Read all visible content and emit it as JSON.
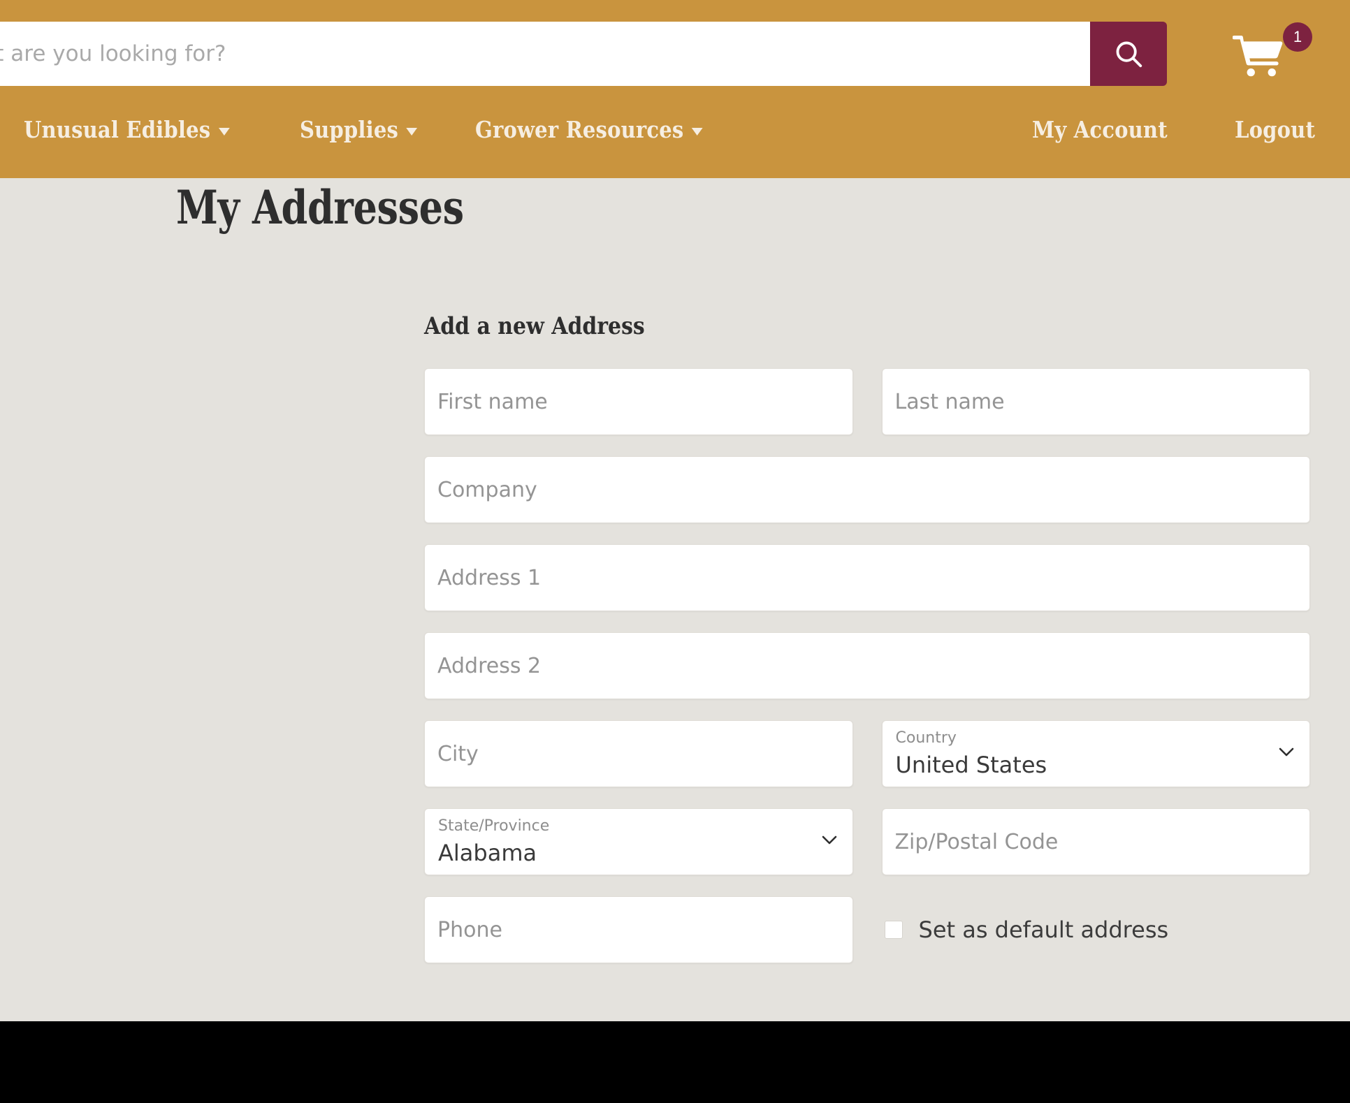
{
  "theme": {
    "gold": "#c9943e",
    "maroon": "#7d2240",
    "page_bg": "#e4e2dd",
    "field_bg": "#ffffff",
    "footer": "#000000"
  },
  "header": {
    "search": {
      "placeholder": "What are you looking for?",
      "value": "",
      "button_icon": "search-icon"
    },
    "cart": {
      "icon": "shopping-cart-icon",
      "count": "1"
    },
    "nav_left": [
      {
        "label": "Unusual Edibles",
        "has_caret": true
      },
      {
        "label": "Supplies",
        "has_caret": true
      },
      {
        "label": "Grower Resources",
        "has_caret": true
      }
    ],
    "nav_right": [
      {
        "label": "My Account",
        "has_caret": false
      },
      {
        "label": "Logout",
        "has_caret": false
      }
    ]
  },
  "main": {
    "page_title": "My Addresses",
    "form": {
      "heading": "Add a new Address",
      "fields": {
        "first_name": {
          "placeholder": "First name",
          "value": ""
        },
        "last_name": {
          "placeholder": "Last name",
          "value": ""
        },
        "company": {
          "placeholder": "Company",
          "value": ""
        },
        "address1": {
          "placeholder": "Address 1",
          "value": ""
        },
        "address2": {
          "placeholder": "Address 2",
          "value": ""
        },
        "city": {
          "placeholder": "City",
          "value": ""
        },
        "zip": {
          "placeholder": "Zip/Postal Code",
          "value": ""
        },
        "phone": {
          "placeholder": "Phone",
          "value": ""
        }
      },
      "country": {
        "label": "Country",
        "value": "United States",
        "chevron_icon": "chevron-down-icon"
      },
      "state": {
        "label": "State/Province",
        "value": "Alabama",
        "chevron_icon": "chevron-down-icon"
      },
      "default_address": {
        "label": "Set as default address",
        "checked": false
      }
    }
  }
}
